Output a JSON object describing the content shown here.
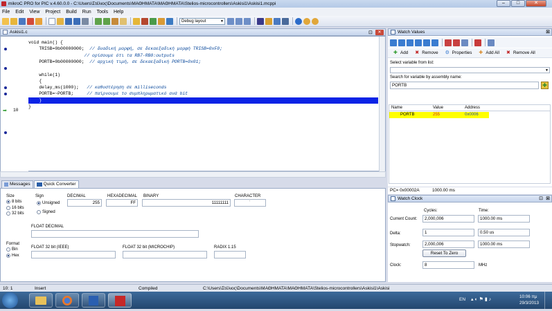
{
  "window": {
    "title": "mikroC PRO for PIC v.4.60.0.0 - C:\\Users\\Στέλιος\\Documents\\ΜΑΘΗΜΑΤΑ\\ΜΑΘΗΜΑΤΑ\\Stelios-microcontrollers\\Askisi1\\Askisi1.mcppi"
  },
  "menu": [
    "File",
    "Edit",
    "View",
    "Project",
    "Build",
    "Run",
    "Tools",
    "Help"
  ],
  "toolbar": {
    "build_config": "Debug layout"
  },
  "editor": {
    "tab_label": "Askisi1.c",
    "current_line_number": "10",
    "lines": [
      {
        "code": "void main() {",
        "comment": ""
      },
      {
        "code": "    TRISB=0b00000000;",
        "comment": "  // δυαδική μορφή, σε δεκαεξαδική μορφή TRISB=0xF0;"
      },
      {
        "code": "",
        "comment": "                     // ορίσουμε ότι τα RB7-RB0:outputs"
      },
      {
        "code": "    PORTB=0b00000000;",
        "comment": "  // αρχική τιμή, σε δεκαεξαδική PORTB=0x01;"
      },
      {
        "code": "",
        "comment": ""
      },
      {
        "code": "    while(1)",
        "comment": ""
      },
      {
        "code": "    {",
        "comment": ""
      },
      {
        "code": "    delay_ms(1000);",
        "comment": "   // καθυστέρηση σε milliseconds"
      },
      {
        "code": "    PORTB=~PORTB;",
        "comment": "     // παίρνουμε το συμπληρωματικό ανά bit"
      },
      {
        "code": "    }",
        "comment": ""
      },
      {
        "code": "}",
        "comment": ""
      }
    ]
  },
  "bottom_tabs": {
    "messages": "Messages",
    "quick_converter": "Quick Converter"
  },
  "converter": {
    "size_label": "Size",
    "size_options": [
      "8 bits",
      "16 bits",
      "32 bits"
    ],
    "sign_label": "Sign",
    "sign_options": [
      "Unsigned",
      "Signed"
    ],
    "decimal_label": "DECIMAL",
    "decimal_value": "255",
    "hex_label": "HEXADECIMAL",
    "hex_value": "FF",
    "binary_label": "BINARY",
    "binary_value": "11111111",
    "character_label": "CHARACTER",
    "character_value": "˙",
    "float_decimal_label": "FLOAT DECIMAL",
    "format_label": "Format",
    "format_options": [
      "Bin",
      "Hex"
    ],
    "float_ieee_label": "FLOAT 32 bit (IEEE)",
    "float_microchip_label": "FLOAT 32 bit (MICROCHIP)",
    "radix_label": "RADIX 1.15"
  },
  "watch": {
    "panel_title": "Watch Values",
    "actions": {
      "add": "Add",
      "remove": "Remove",
      "properties": "Properties",
      "add_all": "Add All",
      "remove_all": "Remove All"
    },
    "select_label": "Select variable from list:",
    "search_label": "Search for variable by assembly name:",
    "search_value": "PORTB",
    "columns": [
      "Name",
      "Value",
      "Address"
    ],
    "rows": [
      {
        "name": "PORTB",
        "value": "255",
        "address": "0x0006"
      }
    ],
    "pc_label": "PC= 0x00002A",
    "pc_time": "1000.00 ms",
    "accent_color": "#ffff00"
  },
  "clock": {
    "panel_title": "Watch Clock",
    "cycles_label": "Cycles:",
    "time_label": "Time:",
    "current_count_label": "Current Count:",
    "current_count_cycles": "2,000,006",
    "current_count_time": "1000.00 ms",
    "delta_label": "Delta:",
    "delta_cycles": "1",
    "delta_time": "0.50 us",
    "stopwatch_label": "Stopwatch:",
    "stopwatch_cycles": "2,000,006",
    "stopwatch_time": "1000.00 ms",
    "reset_button": "Reset To Zero",
    "clock_label": "Clock:",
    "clock_value": "8",
    "clock_unit": "MHz"
  },
  "status": {
    "position": "10: 1",
    "mode": "Insert",
    "build_state": "Compiled",
    "path": "C:\\Users\\Στέλιος\\Documents\\ΜΑΘΗΜΑΤΑ\\ΜΑΘΗΜΑΤΑ\\Stelios-microcontrollers\\Askisi1\\Askisi"
  },
  "taskbar": {
    "lang": "EN",
    "time": "10:06 πμ",
    "date": "29/3/2013"
  }
}
